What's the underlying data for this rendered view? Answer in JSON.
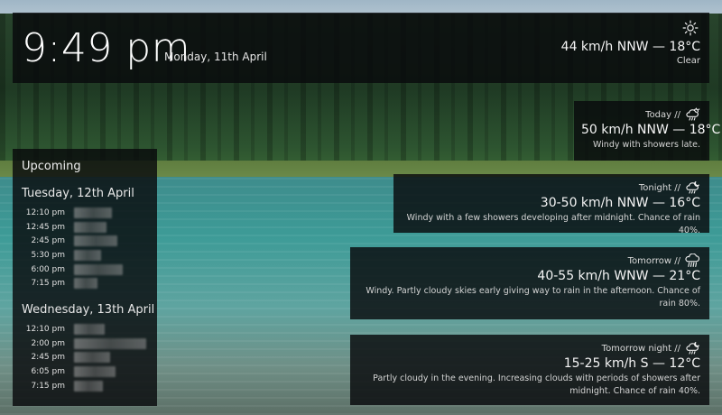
{
  "clock": {
    "time": "9:49 pm",
    "date": "Monday, 11th April"
  },
  "current_weather": {
    "icon": "sun-icon",
    "wind_temp": "44 km/h NNW — 18°C",
    "condition": "Clear"
  },
  "forecast": [
    {
      "period": "Today //",
      "icon": "cloud-rain-sun-icon",
      "wind_temp": "50 km/h NNW — 18°C",
      "description": "Windy with showers late."
    },
    {
      "period": "Tonight //",
      "icon": "cloud-rain-moon-icon",
      "wind_temp": "30-50 km/h NNW — 16°C",
      "description": "Windy with a few showers developing after midnight. Chance of rain 40%."
    },
    {
      "period": "Tomorrow //",
      "icon": "cloud-rain-icon",
      "wind_temp": "40-55 km/h WNW — 21°C",
      "description": "Windy. Partly cloudy skies early giving way to rain in the afternoon. Chance of rain 80%."
    },
    {
      "period": "Tomorrow night //",
      "icon": "cloud-rain-moon-icon",
      "wind_temp": "15-25 km/h S — 12°C",
      "description": "Partly cloudy in the evening. Increasing clouds with periods of showers after midnight. Chance of rain 40%."
    }
  ],
  "upcoming": {
    "title": "Upcoming",
    "days": [
      {
        "label": "Tuesday, 12th April",
        "events": [
          {
            "time": "12:10 pm"
          },
          {
            "time": "12:45 pm"
          },
          {
            "time": "2:45 pm"
          },
          {
            "time": "5:30 pm"
          },
          {
            "time": "6:00 pm"
          },
          {
            "time": "7:15 pm"
          }
        ]
      },
      {
        "label": "Wednesday, 13th April",
        "events": [
          {
            "time": "12:10 pm"
          },
          {
            "time": "2:00 pm"
          },
          {
            "time": "2:45 pm"
          },
          {
            "time": "6:05 pm"
          },
          {
            "time": "7:15 pm"
          }
        ]
      }
    ]
  }
}
